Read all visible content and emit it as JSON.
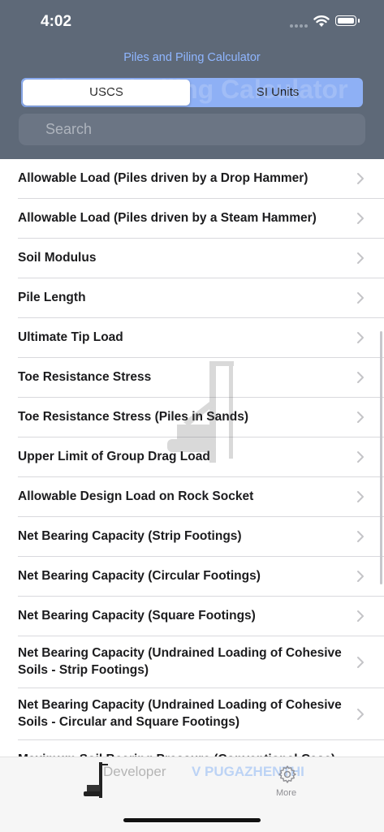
{
  "status": {
    "time": "4:02"
  },
  "header": {
    "nav_title": "Piles and Piling Calculator",
    "large_title": "Pile and Piling Calculator",
    "units": {
      "options": [
        "USCS",
        "SI Units"
      ],
      "selected": "USCS"
    },
    "search": {
      "placeholder": "Search"
    }
  },
  "list": {
    "items": [
      "Allowable Load (Piles driven by a Drop Hammer)",
      "Allowable Load (Piles driven by a Steam Hammer)",
      "Soil Modulus",
      "Pile Length",
      "Ultimate Tip Load",
      "Toe Resistance Stress",
      "Toe Resistance Stress (Piles in Sands)",
      "Upper Limit of Group Drag Load",
      "Allowable Design Load on Rock Socket",
      "Net Bearing Capacity (Strip Footings)",
      "Net Bearing Capacity (Circular Footings)",
      "Net Bearing Capacity (Square Footings)",
      "Net Bearing Capacity (Undrained Loading of Cohesive Soils - Strip Footings)",
      "Net Bearing Capacity (Undrained Loading of Cohesive Soils - Circular and Square Footings)",
      "Maximum Soil Bearing Pressure (Conventional Case)"
    ]
  },
  "tabbar": {
    "developer_label": "Developer",
    "author": "V PUGAZHENTHI",
    "more_label": "More"
  },
  "colors": {
    "header_bg": "#5e6978",
    "segment_bg": "#8eb0f5",
    "nav_title": "#8fb6ff",
    "tab_author": "#bcd3f5"
  },
  "icons": [
    "signal-icon",
    "wifi-icon",
    "battery-icon",
    "chevron-right-icon",
    "pile-rig-icon",
    "gear-icon"
  ]
}
